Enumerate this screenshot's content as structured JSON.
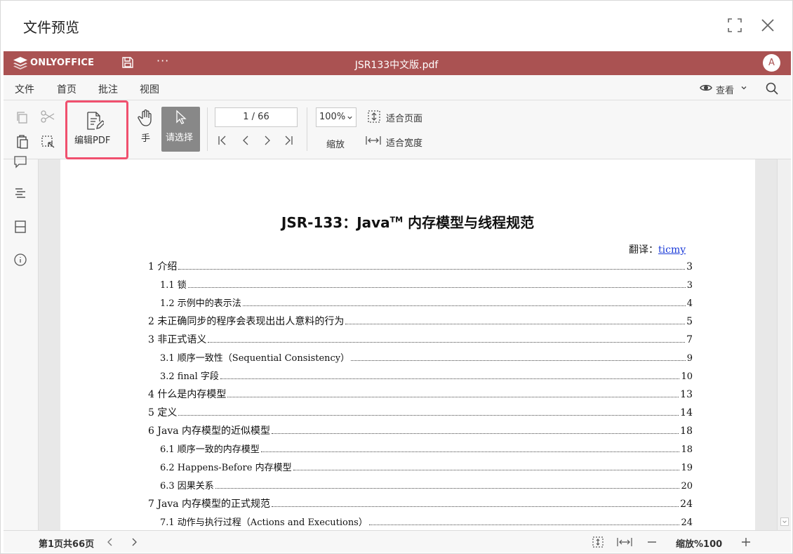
{
  "dialog": {
    "title": "文件预览"
  },
  "app": {
    "brand": "ONLYOFFICE",
    "doc_title": "JSR133中文版.pdf",
    "avatar_initial": "A",
    "accent_color": "#aa5252"
  },
  "menu": {
    "tabs": [
      {
        "label": "文件"
      },
      {
        "label": "首页"
      },
      {
        "label": "批注"
      },
      {
        "label": "视图"
      }
    ],
    "view_label": "查看"
  },
  "toolbar": {
    "edit_pdf_label": "编辑PDF",
    "hand_label": "手",
    "select_label": "请选择",
    "page_value": "1 / 66",
    "zoom_value": "100%",
    "zoom_label": "缩放",
    "fit_page_label": "适合页面",
    "fit_width_label": "适合宽度"
  },
  "document": {
    "title_main": "JSR-133：Java",
    "title_tm": "TM",
    "title_rest": " 内存模型与线程规范",
    "translator_label": "翻译：",
    "translator_name": "ticmy",
    "toc": [
      {
        "text": "1  介绍",
        "page": "3",
        "level": 1
      },
      {
        "text": "1.1  锁",
        "page": "3",
        "level": 2
      },
      {
        "text": "1.2  示例中的表示法",
        "page": "4",
        "level": 2
      },
      {
        "text": "2  未正确同步的程序会表现出出人意料的行为",
        "page": "5",
        "level": 1
      },
      {
        "text": "3  非正式语义",
        "page": "7",
        "level": 1
      },
      {
        "text": "3.1  顺序一致性（Sequential Consistency）",
        "page": "9",
        "level": 2
      },
      {
        "text": "3.2 final 字段",
        "page": "10",
        "level": 2
      },
      {
        "text": "4  什么是内存模型",
        "page": "13",
        "level": 1
      },
      {
        "text": "5  定义",
        "page": "14",
        "level": 1
      },
      {
        "text": "6 Java 内存模型的近似模型",
        "page": "18",
        "level": 1
      },
      {
        "text": "6.1  顺序一致的内存模型",
        "page": "18",
        "level": 2
      },
      {
        "text": "6.2 Happens-Before 内存模型",
        "page": "19",
        "level": 2
      },
      {
        "text": "6.3  因果关系",
        "page": "20",
        "level": 2
      },
      {
        "text": "7 Java 内存模型的正式规范",
        "page": "24",
        "level": 1
      },
      {
        "text": "7.1  动作与执行过程（Actions and Executions）",
        "page": "24",
        "level": 2
      }
    ]
  },
  "statusbar": {
    "page_info": "第1页共66页",
    "zoom_info": "缩放%100"
  }
}
